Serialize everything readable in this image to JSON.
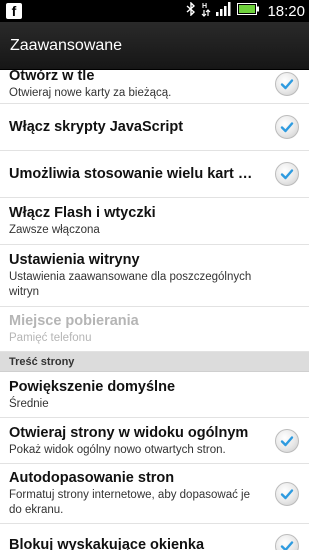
{
  "status_bar": {
    "left_icon": "facebook-icon",
    "icons": [
      "bluetooth-icon",
      "data-transfer-icon",
      "signal-icon",
      "battery-icon"
    ],
    "time": "18:20"
  },
  "title_bar": {
    "title": "Zaawansowane"
  },
  "settings": [
    {
      "title": "Otwórz w tle",
      "subtitle": "Otwieraj nowe karty za bieżącą.",
      "checked": true
    },
    {
      "title": "Włącz skrypty JavaScript",
      "subtitle": "",
      "checked": true
    },
    {
      "title": "Umożliwia stosowanie wielu kart w aplikacji",
      "subtitle": "",
      "checked": true
    },
    {
      "title": "Włącz Flash i wtyczki",
      "subtitle": "Zawsze włączona",
      "checked": null
    },
    {
      "title": "Ustawienia witryny",
      "subtitle": "Ustawienia zaawansowane dla poszczególnych witryn",
      "checked": null
    },
    {
      "title": "Miejsce pobierania",
      "subtitle": "Pamięć telefonu",
      "checked": null,
      "disabled": true
    }
  ],
  "section": {
    "label": "Treść strony"
  },
  "content_settings": [
    {
      "title": "Powiększenie domyślne",
      "subtitle": "Średnie",
      "checked": null
    },
    {
      "title": "Otwieraj strony w widoku ogólnym",
      "subtitle": "Pokaż widok ogólny nowo otwartych stron.",
      "checked": true
    },
    {
      "title": "Autodopasowanie stron",
      "subtitle": "Formatuj strony internetowe, aby dopasować je do ekranu.",
      "checked": true
    },
    {
      "title": "Blokuj wyskakujące okienka",
      "subtitle": "",
      "checked": true
    }
  ],
  "colors": {
    "check_mark": "#2e9be0",
    "title_bar": "#1e1e1e",
    "section_bg": "#dcdcdc"
  }
}
